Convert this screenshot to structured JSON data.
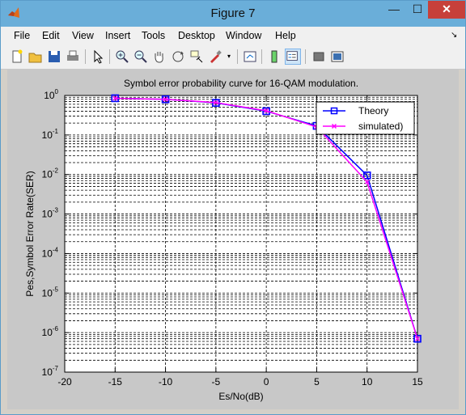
{
  "window": {
    "title": "Figure 7",
    "controls": {
      "minimize": "—",
      "maximize": "☐",
      "close": "✕"
    }
  },
  "menu": [
    "File",
    "Edit",
    "View",
    "Insert",
    "Tools",
    "Desktop",
    "Window",
    "Help"
  ],
  "toolbar": {
    "icons": [
      "new-figure-icon",
      "open-file-icon",
      "save-icon",
      "print-icon",
      "select-arrow-icon",
      "zoom-in-icon",
      "zoom-out-icon",
      "pan-hand-icon",
      "rotate-3d-icon",
      "data-cursor-icon",
      "brush-icon",
      "brush-dropdown-icon",
      "link-plot-icon",
      "colorbar-icon",
      "legend-icon",
      "hide-plot-tools-icon",
      "show-plot-tools-icon"
    ]
  },
  "chart_data": {
    "type": "line",
    "title": "Symbol error probability curve for 16-QAM modulation.",
    "xlabel": "Es/No(dB)",
    "ylabel": "Pes,Symbol Error Rate(SER)",
    "xlim": [
      -20,
      15
    ],
    "ylim": [
      1e-07,
      1
    ],
    "yscale": "log",
    "grid": true,
    "legend_position": "top-right",
    "x_ticks": [
      "-20",
      "-15",
      "-10",
      "-5",
      "0",
      "5",
      "10",
      "15"
    ],
    "y_tick_exponents": [
      "0",
      "-1",
      "-2",
      "-3",
      "-4",
      "-5",
      "-6",
      "-7"
    ],
    "series": [
      {
        "name": "Theory",
        "color": "#0000ff",
        "marker": "square",
        "x": [
          -15,
          -10,
          -5,
          0,
          5,
          10,
          15
        ],
        "y": [
          0.85,
          0.8,
          0.65,
          0.4,
          0.17,
          0.0095,
          7e-07
        ]
      },
      {
        "name": "simulated)",
        "color": "#ff00ff",
        "marker": "x",
        "x": [
          -15,
          -10,
          -5,
          0,
          5,
          10,
          15
        ],
        "y": [
          0.85,
          0.8,
          0.66,
          0.41,
          0.16,
          0.0065,
          7e-07
        ]
      }
    ]
  }
}
